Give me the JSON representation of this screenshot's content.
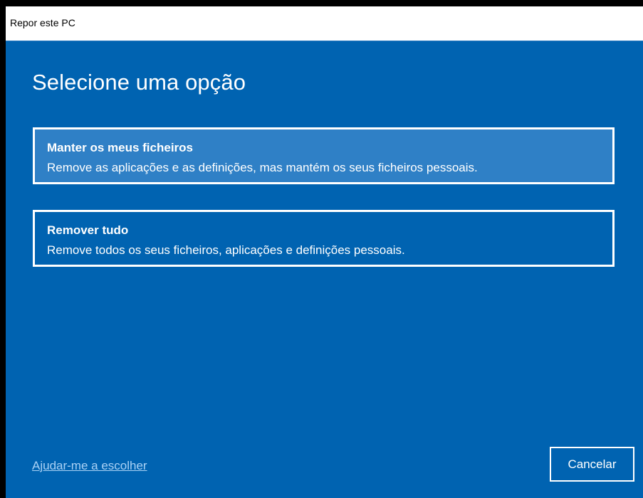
{
  "window": {
    "title": "Repor este PC"
  },
  "main": {
    "heading": "Selecione uma opção",
    "options": [
      {
        "title": "Manter os meus ficheiros",
        "description": "Remove as aplicações e as definições, mas mantém os seus ficheiros pessoais."
      },
      {
        "title": "Remover tudo",
        "description": "Remove todos os seus ficheiros, aplicações e definições pessoais."
      }
    ]
  },
  "footer": {
    "help_link": "Ajudar-me a escolher",
    "cancel_label": "Cancelar"
  },
  "colors": {
    "background": "#0063B1",
    "option_highlight": "#2F80C6",
    "link": "#A9D1F5",
    "text": "#FFFFFF"
  }
}
